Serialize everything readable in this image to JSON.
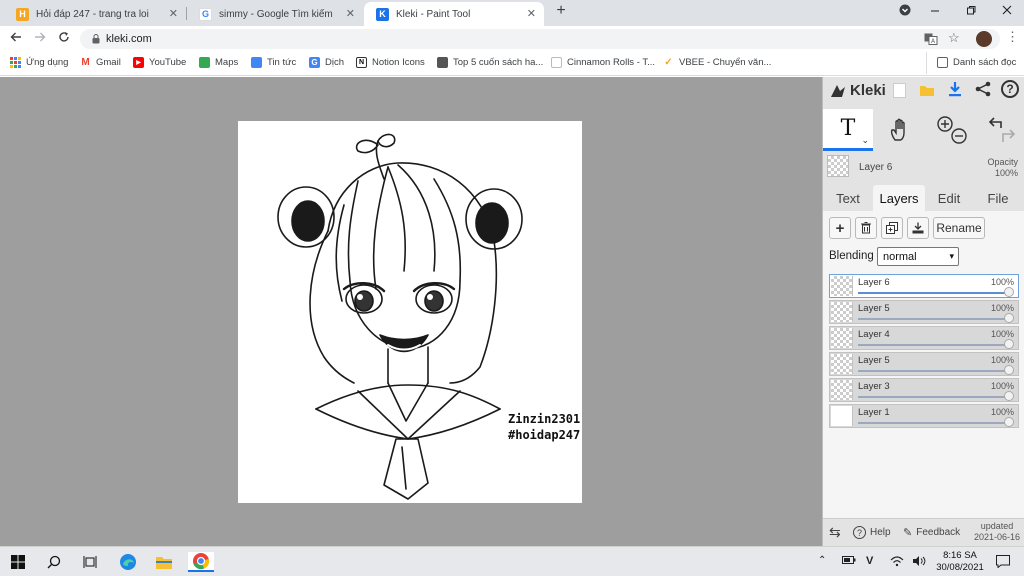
{
  "browser": {
    "tabs": [
      {
        "title": "Hỏi đáp 247 - trang tra loi",
        "favicon_letter": "H",
        "favicon_color": "#f5a623"
      },
      {
        "title": "simmy - Google Tìm kiếm",
        "favicon_letter": "G",
        "favicon_color": "#4285f4"
      },
      {
        "title": "Kleki - Paint Tool",
        "favicon_letter": "K",
        "favicon_color": "#1a73e8"
      }
    ],
    "close_glyph": "✕",
    "new_tab_glyph": "+",
    "url": "kleki.com"
  },
  "bookmarks": {
    "items": [
      {
        "label": "Ứng dụng",
        "icon": "apps-grid-icon",
        "color": "#4285f4"
      },
      {
        "label": "Gmail",
        "icon": "gmail-icon",
        "color": "#ea4335"
      },
      {
        "label": "YouTube",
        "icon": "youtube-icon",
        "color": "#ff0000"
      },
      {
        "label": "Maps",
        "icon": "maps-icon",
        "color": "#34a853"
      },
      {
        "label": "Tin tức",
        "icon": "news-icon",
        "color": "#4285f4"
      },
      {
        "label": "Dịch",
        "icon": "translate-icon",
        "color": "#4285f4"
      },
      {
        "label": "Notion Icons",
        "icon": "notion-icon",
        "color": "#000000"
      },
      {
        "label": "Top 5 cuốn sách ha...",
        "icon": "book-icon",
        "color": "#555555"
      },
      {
        "label": "Cinnamon Rolls - T...",
        "icon": "page-icon",
        "color": "#bbbbbb"
      },
      {
        "label": "VBEE - Chuyển văn...",
        "icon": "vbee-icon",
        "color": "#f5a623"
      }
    ],
    "reading_list": "Danh sách đọc"
  },
  "canvas": {
    "signature_line1": "Zinzin2301",
    "signature_line2": "#hoidap247"
  },
  "kleki": {
    "logo": "Kleki",
    "current_layer": "Layer 6",
    "opacity_label": "Opacity",
    "opacity_value": "100%",
    "tabs": [
      "Text",
      "Layers",
      "Edit",
      "File"
    ],
    "rename_label": "Rename",
    "blending_label": "Blending",
    "blending_value": "normal",
    "layers": [
      {
        "name": "Layer 6",
        "opacity": "100%",
        "selected": true
      },
      {
        "name": "Layer 5",
        "opacity": "100%",
        "selected": false
      },
      {
        "name": "Layer 4",
        "opacity": "100%",
        "selected": false
      },
      {
        "name": "Layer 5",
        "opacity": "100%",
        "selected": false
      },
      {
        "name": "Layer 3",
        "opacity": "100%",
        "selected": false
      },
      {
        "name": "Layer 1",
        "opacity": "100%",
        "selected": false
      }
    ],
    "help_label": "Help",
    "feedback_label": "Feedback",
    "updated_label": "updated",
    "updated_date": "2021-06-16"
  },
  "taskbar": {
    "time": "8:16 SA",
    "date": "30/08/2021"
  },
  "colors": {
    "workspace_bg": "#9e9e9e",
    "panel_bg": "#e3e3e3",
    "accent_blue": "#1a73e8"
  }
}
